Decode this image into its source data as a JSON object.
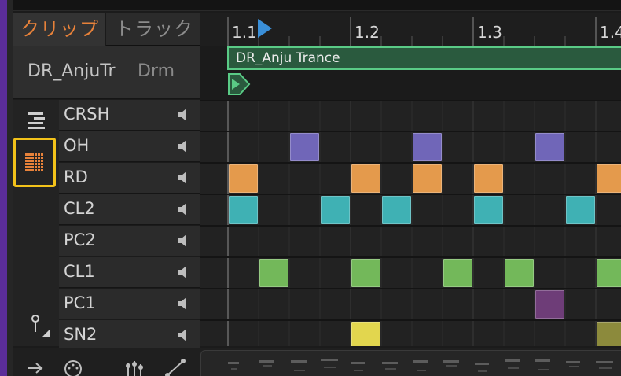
{
  "tabs": {
    "clip": "クリップ",
    "track": "トラック",
    "active": "clip"
  },
  "clip": {
    "name": "DR_AnjuTr",
    "track_short": "Drm",
    "banner_title": "DR_Anju Trance"
  },
  "ruler": {
    "labels": [
      "1.1",
      "1.2",
      "1.3",
      "1.4"
    ]
  },
  "lanes": [
    {
      "name": "CRSH"
    },
    {
      "name": "OH"
    },
    {
      "name": "RD"
    },
    {
      "name": "CL2"
    },
    {
      "name": "PC2"
    },
    {
      "name": "CL1"
    },
    {
      "name": "PC1"
    },
    {
      "name": "SN2"
    }
  ],
  "colors": {
    "tab_active": "#e8823a",
    "highlight": "#f2c21a",
    "clip_green": "#5acb86",
    "playhead": "#3a8fd8",
    "OH": "#7066b8",
    "RD": "#e49a4c",
    "CL2": "#3fb1b4",
    "CL1": "#73b85a",
    "PC1": "#6e3d78",
    "SN2": "#e2d64e",
    "SN2_dim": "#8c8a3c"
  },
  "pattern": {
    "steps_per_bar": 16,
    "notes": {
      "OH": [
        2,
        6,
        10
      ],
      "RD": [
        0,
        4,
        6,
        8,
        12
      ],
      "CL2": [
        0,
        3,
        5,
        8,
        11
      ],
      "CL1": [
        1,
        4,
        7,
        9,
        12
      ],
      "PC1": [
        10
      ],
      "SN2": [
        4,
        12
      ]
    }
  },
  "icons": {
    "lanes_view": "lines-icon",
    "drum_grid": "grid-icon",
    "pin": "pin-icon",
    "speaker": "speaker-icon",
    "arrow": "arrow-right-icon",
    "knob": "knob-icon",
    "sliders": "sliders-icon",
    "curve": "curve-icon"
  }
}
